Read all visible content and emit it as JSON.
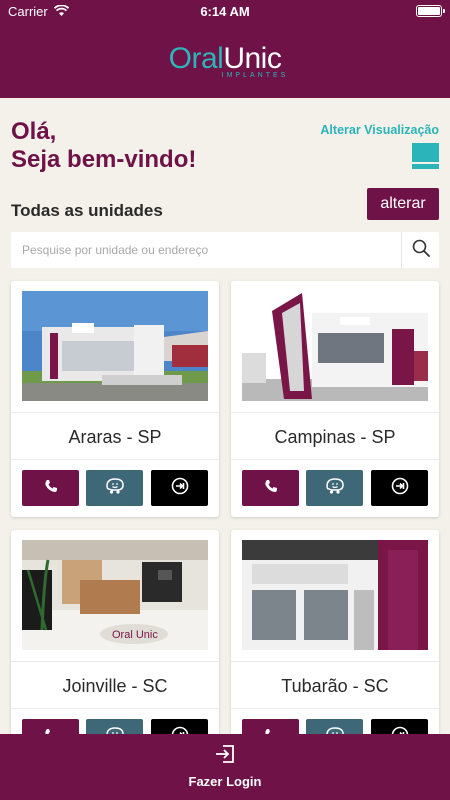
{
  "status_bar": {
    "carrier": "Carrier",
    "time": "6:14 AM"
  },
  "header": {
    "logo_oral": "Oral",
    "logo_unic": "Unic",
    "logo_sub": "IMPLANTES"
  },
  "greeting": {
    "line1": "Olá,",
    "line2": "Seja bem-vindo!"
  },
  "view_toggle": {
    "label": "Alterar Visualização",
    "icon": "layout-view-icon"
  },
  "section": {
    "title": "Todas as unidades",
    "change_label": "alterar"
  },
  "search": {
    "placeholder": "Pesquise por unidade ou endereço",
    "value": "",
    "icon": "search-icon"
  },
  "units": [
    {
      "name": "Araras - SP"
    },
    {
      "name": "Campinas - SP"
    },
    {
      "name": "Joinville - SC"
    },
    {
      "name": "Tubarão - SC"
    }
  ],
  "actions": {
    "phone_icon": "phone-icon",
    "waze_icon": "waze-icon",
    "route_icon": "route-icon"
  },
  "footer": {
    "login_label": "Fazer Login",
    "icon": "login-icon"
  },
  "colors": {
    "primary": "#6e1248",
    "accent": "#2bb5b8",
    "waze": "#3e6878",
    "background": "#f4f0ea"
  }
}
